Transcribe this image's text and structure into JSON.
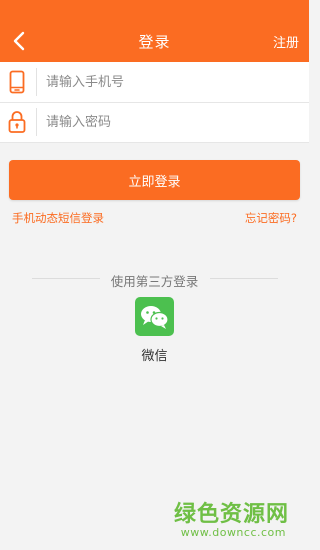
{
  "header": {
    "title": "登录",
    "register_label": "注册",
    "back_icon": "chevron-left-icon"
  },
  "form": {
    "phone": {
      "placeholder": "请输入手机号",
      "value": "",
      "icon": "mobile-phone-icon"
    },
    "password": {
      "placeholder": "请输入密码",
      "value": "",
      "icon": "lock-icon"
    }
  },
  "actions": {
    "login_label": "立即登录",
    "sms_login_label": "手机动态短信登录",
    "forgot_label": "忘记密码?"
  },
  "third_party": {
    "label": "使用第三方登录",
    "wechat_label": "微信",
    "wechat_icon": "wechat-icon"
  },
  "watermark": {
    "name": "绿色资源网",
    "url": "www.downcc.com"
  },
  "colors": {
    "accent": "#fb6c22",
    "wechat": "#4cc04f",
    "watermark": "#6fbf45",
    "background": "#f3f3f3"
  }
}
